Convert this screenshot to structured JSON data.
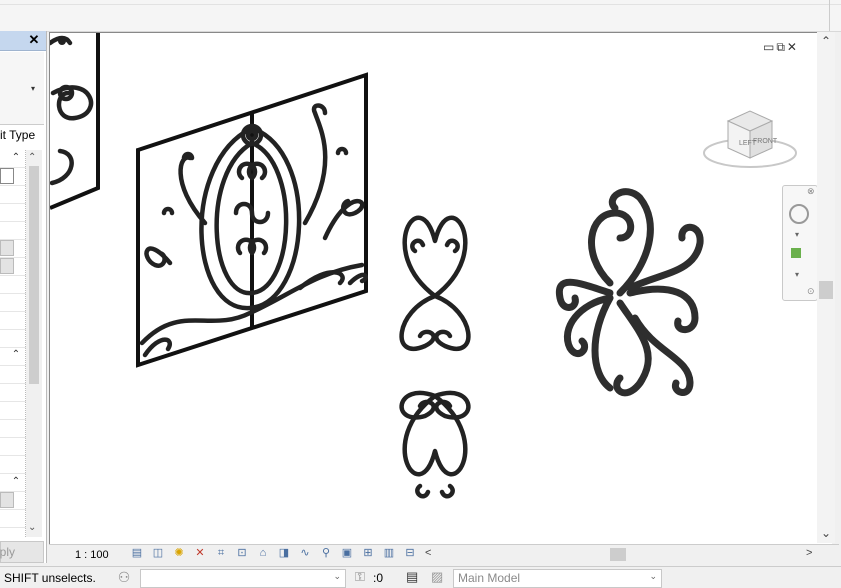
{
  "properties_panel": {
    "close_glyph": "✕",
    "edit_type_label": "it Type",
    "apply_label": "pply",
    "collapse_glyph": "⌃",
    "dropdown_glyph": "▾"
  },
  "canvas": {
    "window_controls": "▭⧉✕",
    "viewcube": {
      "left_label": "LEFT",
      "front_label": "FRONT"
    },
    "scroll_up": "⌃",
    "scroll_down": "⌄"
  },
  "view_control_bar": {
    "scale": "1 : 100",
    "scroll_left": "<",
    "scroll_right": ">"
  },
  "status_bar": {
    "message": "SHIFT unselects.",
    "workset_value": "",
    "editable_requests": ":0",
    "active_model": "Main Model",
    "dropdown_glyph": "⌄"
  },
  "colors": {
    "panel_header": "#c5d7ee",
    "canvas_bg": "#ffffff",
    "ironwork": "#222222"
  }
}
